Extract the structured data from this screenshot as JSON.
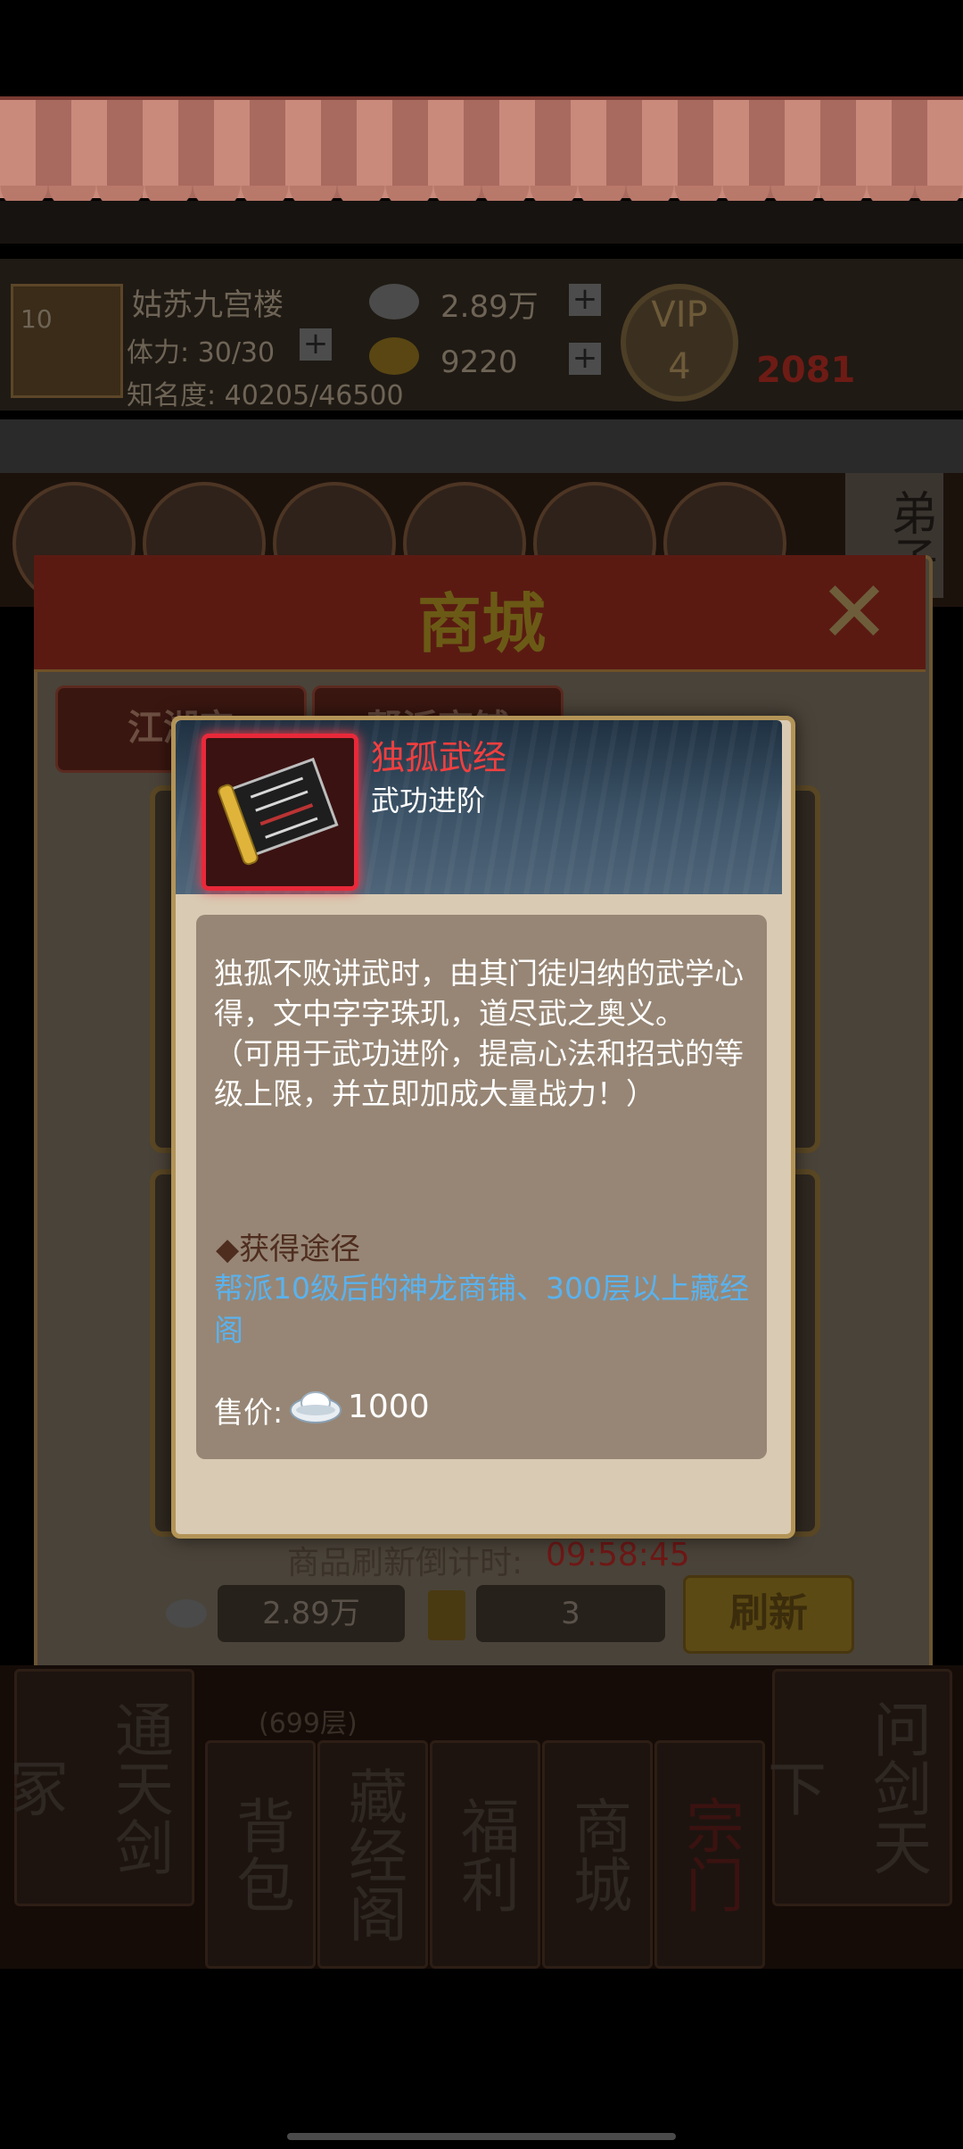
{
  "background": {
    "player_name": "姑苏九宫楼",
    "stamina": "体力: 30/30",
    "fame": "知名度: 40205/46500",
    "silver_amount": "2.89万",
    "gold_amount": "9220",
    "level": "10",
    "vip_label": "VIP",
    "vip_level": "4",
    "power_value": "2081",
    "disciple_label": "弟子"
  },
  "shop": {
    "title": "商城",
    "tabs": [
      "江湖宝",
      "帮派商铺"
    ],
    "countdown_label": "商品刷新倒计时:",
    "countdown_value": "09:58:45",
    "silver_balance": "2.89万",
    "token_count": "3",
    "refresh_label": "刷新"
  },
  "bottom_nav": {
    "tabs": [
      "通天剑冢",
      "背包",
      "藏经阁",
      "福利",
      "商城",
      "宗门",
      "问剑天下"
    ],
    "tower_floor": "(699层)"
  },
  "item_modal": {
    "name": "独孤武经",
    "category": "武功进阶",
    "description": "独孤不败讲武时，由其门徒归纳的武学心得，文中字字珠玑，道尽武之奥义。\n（可用于武功进阶，提高心法和招式的等级上限，并立即加成大量战力！）",
    "source_title": "◆获得途径",
    "source_text": "帮派10级后的神龙商铺、300层以上藏经阁",
    "price_label": "售价:",
    "price_value": "1000",
    "price_icon": "silver-ingot-icon",
    "colors": {
      "name": "#f13f3f",
      "source": "#5ab2ee"
    }
  }
}
